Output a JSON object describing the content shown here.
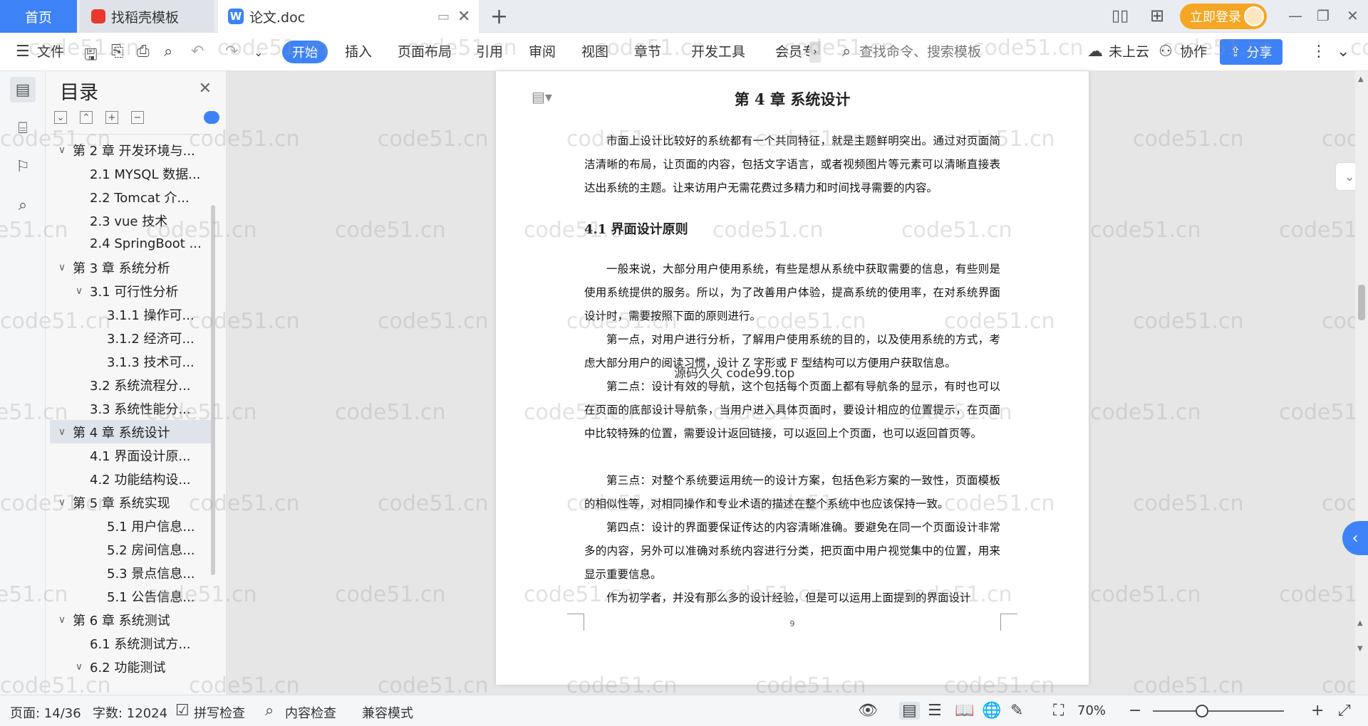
{
  "tabs": {
    "home": "首页",
    "template": "找稻壳模板",
    "document": "论文.doc"
  },
  "login": "立即登录",
  "toolbar": {
    "file": "文件",
    "start": "开始",
    "menu": [
      "插入",
      "页面布局",
      "引用",
      "审阅",
      "视图",
      "章节",
      "开发工具",
      "会员专"
    ],
    "search_placeholder": "查找命令、搜索模板",
    "cloud": "未上云",
    "collab": "协作",
    "share": "分享"
  },
  "toc": {
    "title": "目录",
    "items": [
      {
        "label": "第 2 章  开发环境与...",
        "level": 1,
        "chev": "∨"
      },
      {
        "label": "2.1 MYSQL 数据...",
        "level": 2,
        "chev": ""
      },
      {
        "label": "2.2 Tomcat 介...",
        "level": 2,
        "chev": ""
      },
      {
        "label": "2.3 vue 技术",
        "level": 2,
        "chev": ""
      },
      {
        "label": "2.4 SpringBoot ...",
        "level": 2,
        "chev": ""
      },
      {
        "label": "第 3 章  系统分析",
        "level": 1,
        "chev": "∨"
      },
      {
        "label": "3.1 可行性分析",
        "level": 2,
        "chev": "∨"
      },
      {
        "label": "3.1.1 操作可...",
        "level": 3,
        "chev": ""
      },
      {
        "label": "3.1.2 经济可...",
        "level": 3,
        "chev": ""
      },
      {
        "label": "3.1.3 技术可...",
        "level": 3,
        "chev": ""
      },
      {
        "label": "3.2 系统流程分...",
        "level": 2,
        "chev": ""
      },
      {
        "label": "3.3 系统性能分...",
        "level": 2,
        "chev": ""
      },
      {
        "label": "第 4 章  系统设计",
        "level": 1,
        "chev": "∨",
        "selected": true
      },
      {
        "label": "4.1 界面设计原...",
        "level": 2,
        "chev": ""
      },
      {
        "label": "4.2 功能结构设...",
        "level": 2,
        "chev": ""
      },
      {
        "label": "第 5 章  系统实现",
        "level": 1,
        "chev": "∨"
      },
      {
        "label": "5.1 用户信息...",
        "level": 3,
        "chev": ""
      },
      {
        "label": "5.2  房间信息...",
        "level": 3,
        "chev": ""
      },
      {
        "label": "5.3 景点信息...",
        "level": 3,
        "chev": ""
      },
      {
        "label": "5.1 公告信息...",
        "level": 3,
        "chev": ""
      },
      {
        "label": "第 6 章  系统测试",
        "level": 1,
        "chev": "∨"
      },
      {
        "label": "6.1  系统测试方...",
        "level": 2,
        "chev": ""
      },
      {
        "label": "6.2  功能测试",
        "level": 2,
        "chev": "∨"
      }
    ]
  },
  "document": {
    "chapter_title": "第 4 章  系统设计",
    "intro": "市面上设计比较好的系统都有一个共同特征，就是主题鲜明突出。通过对页面简洁清晰的布局，让页面的内容，包括文字语言，或者视频图片等元素可以清晰直接表达出系统的主题。让来访用户无需花费过多精力和时间找寻需要的内容。",
    "section_title": "4.1 界面设计原则",
    "paragraphs": [
      "一般来说，大部分用户使用系统，有些是想从系统中获取需要的信息，有些则是使用系统提供的服务。所以，为了改善用户体验，提高系统的使用率，在对系统界面设计时，需要按照下面的原则进行。",
      "第一点，对用户进行分析，了解用户使用系统的目的，以及使用系统的方式，考虑大部分用户的阅读习惯，设计 Z 字形或 F 型结构可以方便用户获取信息。",
      "第二点：设计有效的导航，这个包括每个页面上都有导航条的显示，有时也可以在页面的底部设计导航条，当用户进入具体页面时，要设计相应的位置提示，在页面中比较特殊的位置，需要设计返回链接，可以返回上个页面，也可以返回首页等。",
      "第三点：对整个系统要运用统一的设计方案，包括色彩方案的一致性，页面模板的相似性等，对相同操作和专业术语的描述在整个系统中也应该保持一致。",
      "第四点：设计的界面要保证传达的内容清晰准确。要避免在同一个页面设计非常多的内容，另外可以准确对系统内容进行分类，把页面中用户视觉集中的位置，用来显示重要信息。",
      "作为初学者，并没有那么多的设计经验，但是可以运用上面提到的界面设计"
    ],
    "page_number": "9",
    "source_watermark": "源码久久  code99.top"
  },
  "watermark": "code51.cn",
  "status": {
    "page": "页面: 14/36",
    "words": "字数: 12024",
    "spell": "拼写检查",
    "content": "内容检查",
    "compat": "兼容模式",
    "zoom": "70%"
  },
  "colors": {
    "accent": "#3d83f7",
    "login": "#f5a623"
  }
}
